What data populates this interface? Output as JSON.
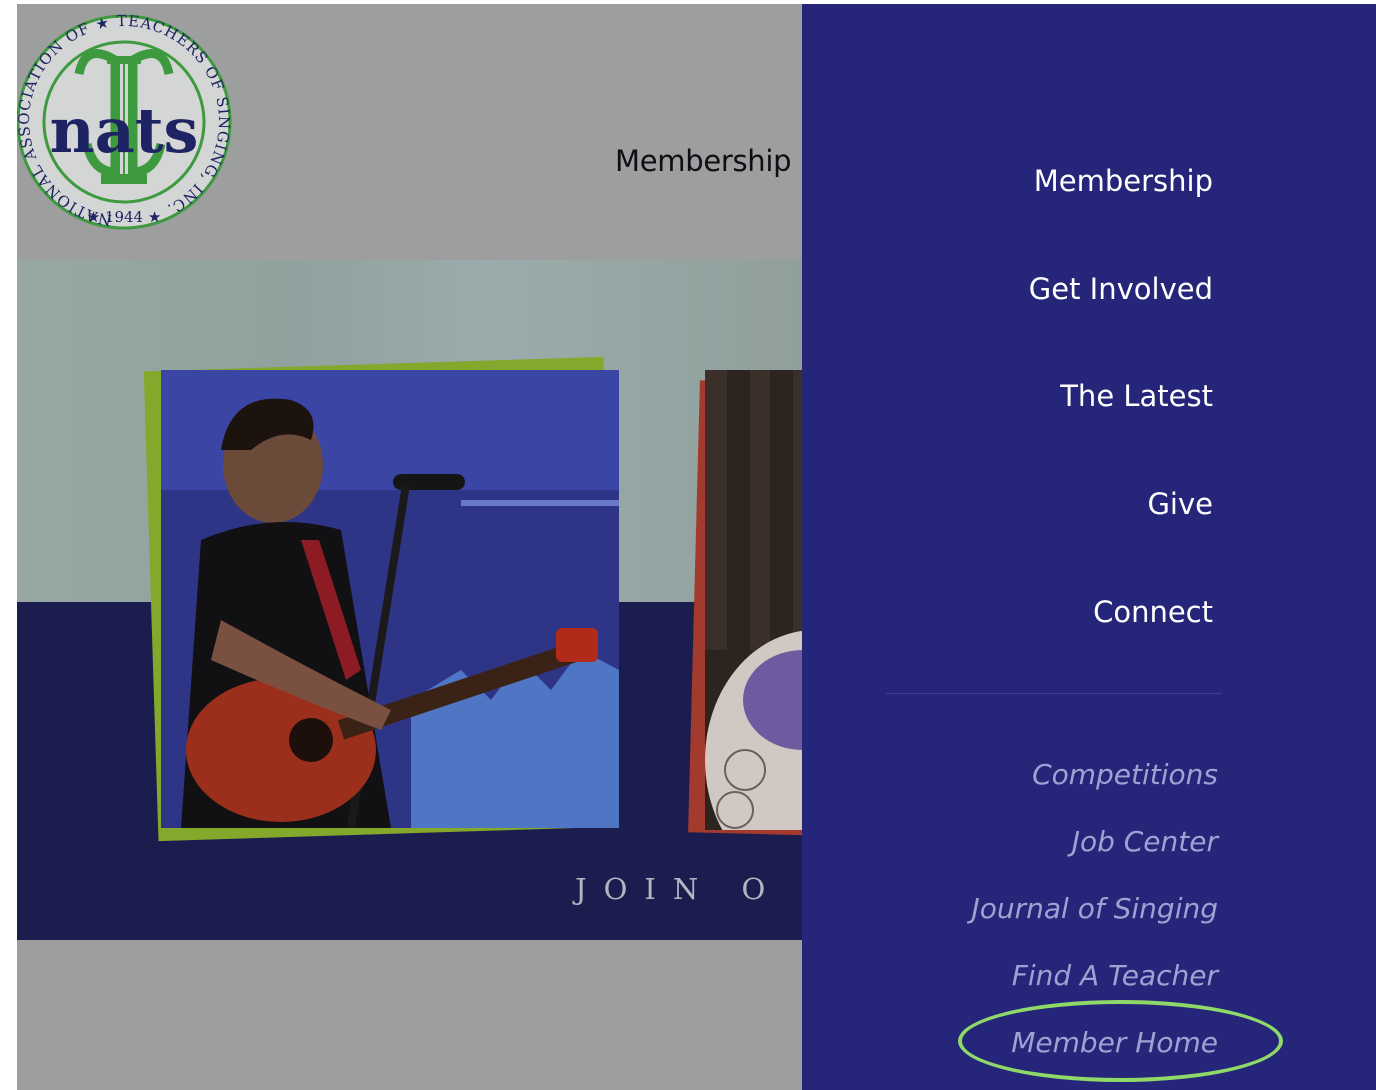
{
  "logo": {
    "ring_text": "NATIONAL ASSOCIATION OF ★ TEACHERS OF SINGING, INC.",
    "year": "★ 1944 ★",
    "wordmark": "nats"
  },
  "header": {
    "membership_label": "Membership"
  },
  "hero": {
    "cta_text": "JOIN O"
  },
  "drawer": {
    "primary_items": [
      {
        "label": "Membership"
      },
      {
        "label": "Get Involved"
      },
      {
        "label": "The Latest"
      },
      {
        "label": "Give"
      },
      {
        "label": "Connect"
      }
    ],
    "secondary_items": [
      {
        "label": "Competitions"
      },
      {
        "label": "Job Center"
      },
      {
        "label": "Journal of Singing"
      },
      {
        "label": "Find A Teacher"
      },
      {
        "label": "Member Home"
      }
    ]
  },
  "colors": {
    "drawer_bg": "#252579",
    "overlay_gray": "#9d9e9e",
    "highlight": "#8fd968",
    "logo_green": "#3e9a3f",
    "logo_navy": "#1d2363"
  },
  "annotation": {
    "highlighted_item": "Member Home"
  }
}
